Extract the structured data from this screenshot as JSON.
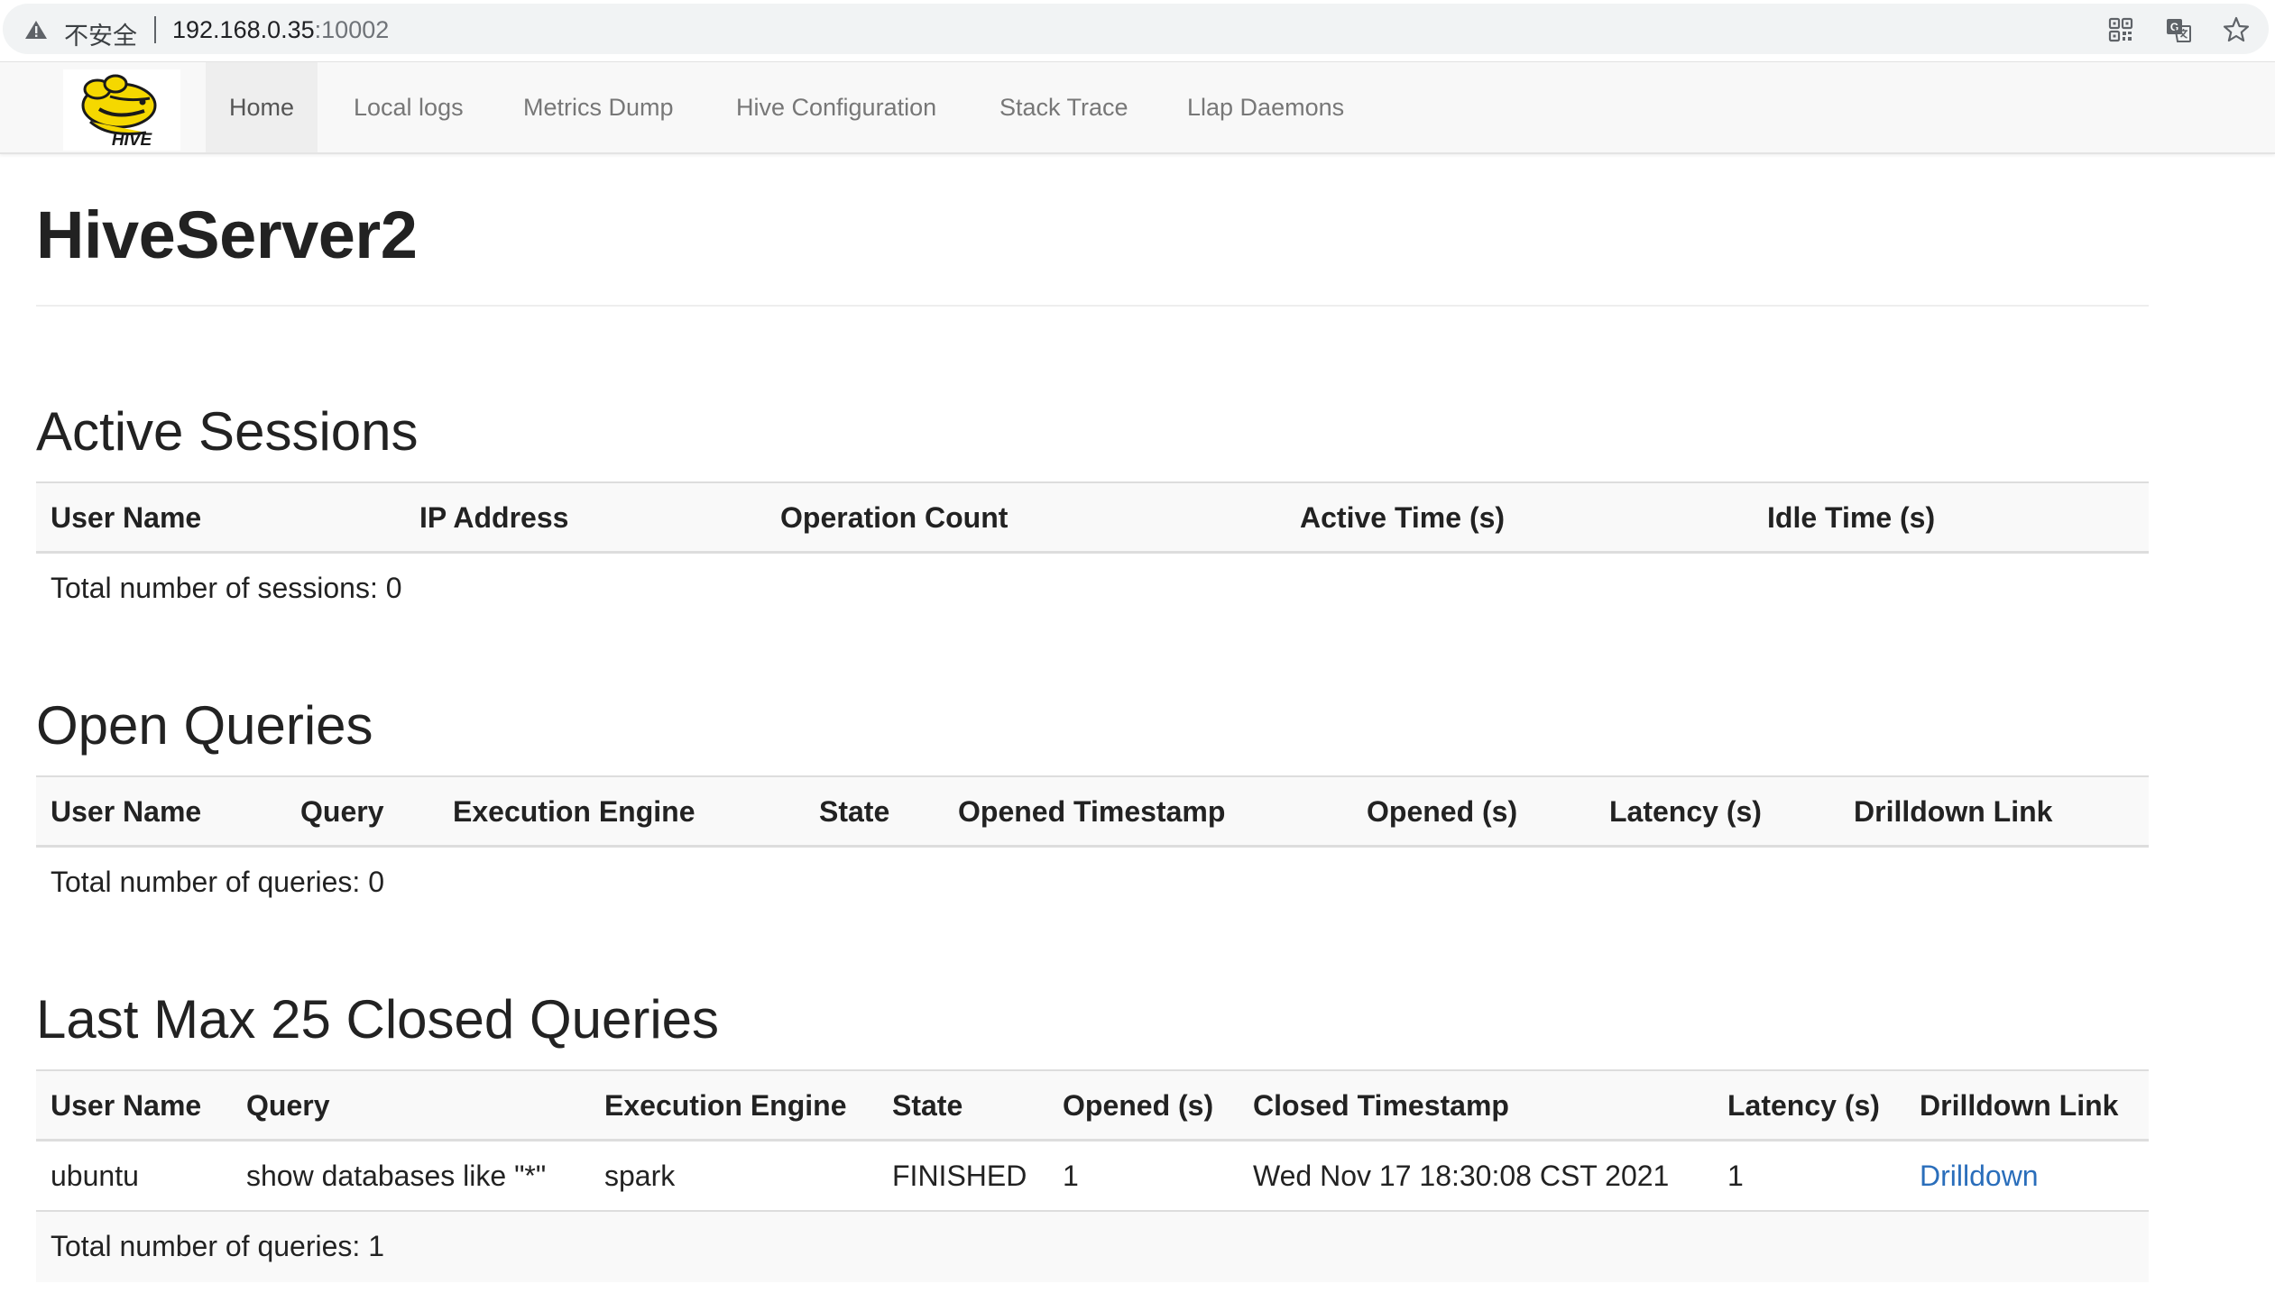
{
  "browser": {
    "security_label": "不安全",
    "url_host": "192.168.0.35",
    "url_port": ":10002",
    "icons": [
      "warning-icon",
      "qr-code-icon",
      "translate-icon",
      "bookmark-star-icon"
    ]
  },
  "navbar": {
    "logo": "hive-logo",
    "logo_text": "HIVE",
    "items": [
      {
        "label": "Home",
        "active": true
      },
      {
        "label": "Local logs"
      },
      {
        "label": "Metrics Dump"
      },
      {
        "label": "Hive Configuration"
      },
      {
        "label": "Stack Trace"
      },
      {
        "label": "Llap Daemons"
      }
    ]
  },
  "page": {
    "title": "HiveServer2"
  },
  "active_sessions": {
    "title": "Active Sessions",
    "columns": [
      "User Name",
      "IP Address",
      "Operation Count",
      "Active Time (s)",
      "Idle Time (s)"
    ],
    "total": "Total number of sessions: 0"
  },
  "open_queries": {
    "title": "Open Queries",
    "columns": [
      "User Name",
      "Query",
      "Execution Engine",
      "State",
      "Opened Timestamp",
      "Opened (s)",
      "Latency (s)",
      "Drilldown Link"
    ],
    "total": "Total number of queries: 0"
  },
  "closed_queries": {
    "title": "Last Max 25 Closed Queries",
    "columns": [
      "User Name",
      "Query",
      "Execution Engine",
      "State",
      "Opened (s)",
      "Closed Timestamp",
      "Latency (s)",
      "Drilldown Link"
    ],
    "rows": [
      {
        "user": "ubuntu",
        "query": "show databases like \"*\"",
        "engine": "spark",
        "state": "FINISHED",
        "opened": "1",
        "closed_ts": "Wed Nov 17 18:30:08 CST 2021",
        "latency": "1",
        "link": "Drilldown"
      }
    ],
    "total": "Total number of queries: 1"
  }
}
